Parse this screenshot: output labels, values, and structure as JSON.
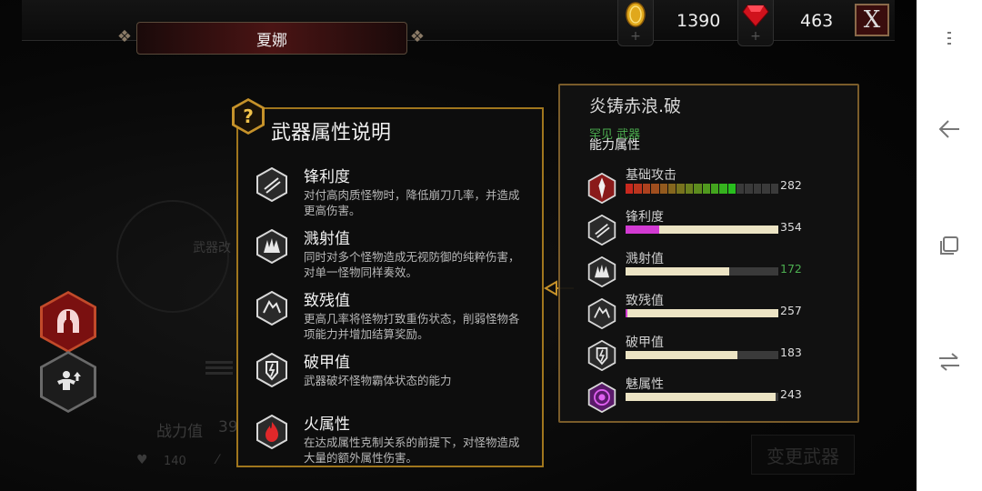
{
  "header": {
    "character_name": "夏娜",
    "gold": {
      "icon": "gold-coin-icon",
      "value": "1390"
    },
    "gems": {
      "icon": "ruby-gem-icon",
      "value": "463"
    },
    "close_label": "X"
  },
  "background": {
    "faded_label": "武器改",
    "power_label": "战力值",
    "power_value": "39",
    "stat_a_value": "140",
    "change_weapon_label": "变更武器"
  },
  "left_buttons": [
    {
      "name": "armor-helmet-button",
      "icon": "spartan-helmet-icon"
    },
    {
      "name": "body-upgrade-button",
      "icon": "muscle-upgrade-icon"
    }
  ],
  "info_popup": {
    "badge_icon": "question-mark-icon",
    "title": "武器属性说明",
    "items": [
      {
        "icon": "sharpness-icon",
        "name": "锋利度",
        "desc": "对付高肉质怪物时，降低崩刀几率，并造成更高伤害。"
      },
      {
        "icon": "splash-icon",
        "name": "溅射值",
        "desc": "同时对多个怪物造成无视防御的纯粹伤害，对单一怪物同样奏效。"
      },
      {
        "icon": "crippling-icon",
        "name": "致残值",
        "desc": "更高几率将怪物打致重伤状态，削弱怪物各项能力并增加结算奖励。"
      },
      {
        "icon": "armor-break-icon",
        "name": "破甲值",
        "desc": "武器破坏怪物霸体状态的能力"
      },
      {
        "icon": "fire-element-icon",
        "name": "火属性",
        "desc": "在达成属性克制关系的前提下，对怪物造成大量的额外属性伤害。"
      }
    ]
  },
  "weapon_panel": {
    "name": "炎铸赤浪.破",
    "rarity": "罕见 武器",
    "ability_header": "能力属性",
    "stats": [
      {
        "icon": "base-attack-icon",
        "label": "基础攻击",
        "value": "282",
        "fraction": 0.7,
        "style": "segmented"
      },
      {
        "icon": "sharpness-icon",
        "label": "锋利度",
        "value": "354",
        "fraction": 1.0,
        "highlight_fraction": 0.22,
        "style": "highlight"
      },
      {
        "icon": "splash-icon",
        "label": "溅射值",
        "value": "172",
        "fraction": 0.68,
        "value_color": "#4caf50",
        "style": "plain"
      },
      {
        "icon": "crippling-icon",
        "label": "致残值",
        "value": "257",
        "fraction": 1.0,
        "highlight_fraction": 0.01,
        "style": "highlight"
      },
      {
        "icon": "armor-break-icon",
        "label": "破甲值",
        "value": "183",
        "fraction": 0.73,
        "style": "plain"
      },
      {
        "icon": "charm-element-icon",
        "label": "魅属性",
        "value": "243",
        "fraction": 0.98,
        "style": "plain"
      }
    ]
  },
  "colors": {
    "accent_gold": "#a0761d",
    "rarity_green": "#4caf50",
    "name_plate_red": "#4a1414",
    "highlight_magenta": "#d23ad2"
  }
}
